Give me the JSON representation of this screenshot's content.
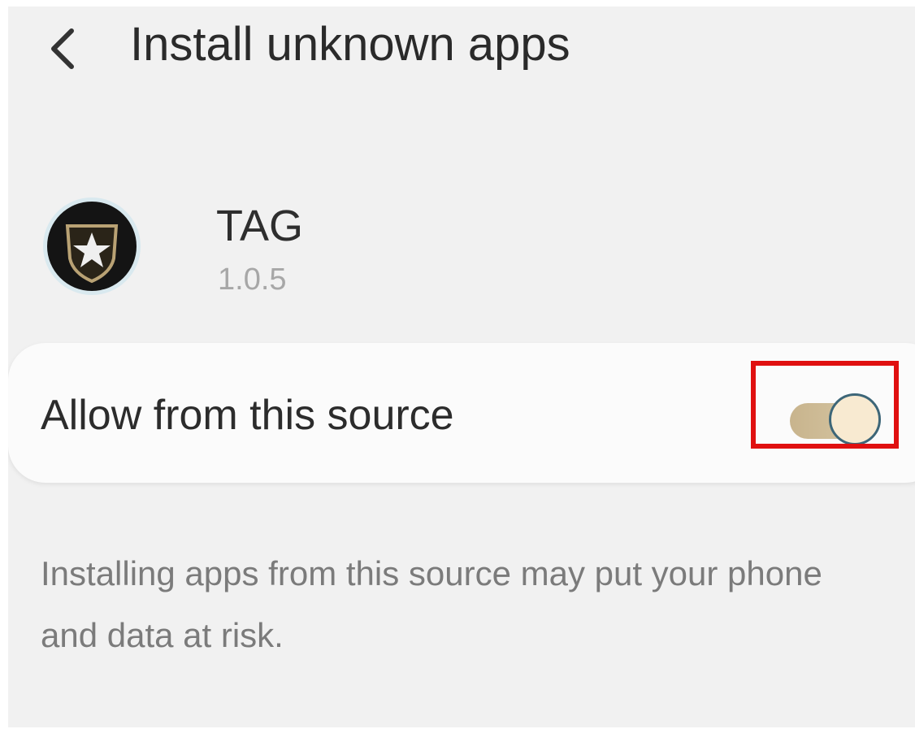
{
  "header": {
    "back_icon": "chevron-left-icon",
    "title": "Install unknown apps"
  },
  "app": {
    "icon": "army-star-shield-icon",
    "name": "TAG",
    "version": "1.0.5"
  },
  "setting": {
    "label": "Allow from this source",
    "enabled": true,
    "track_color": "#c8b48d",
    "thumb_color": "#f8ead1",
    "highlight_color": "#e01010"
  },
  "warning": {
    "text": "Installing apps from this source may put your phone and data at risk."
  }
}
